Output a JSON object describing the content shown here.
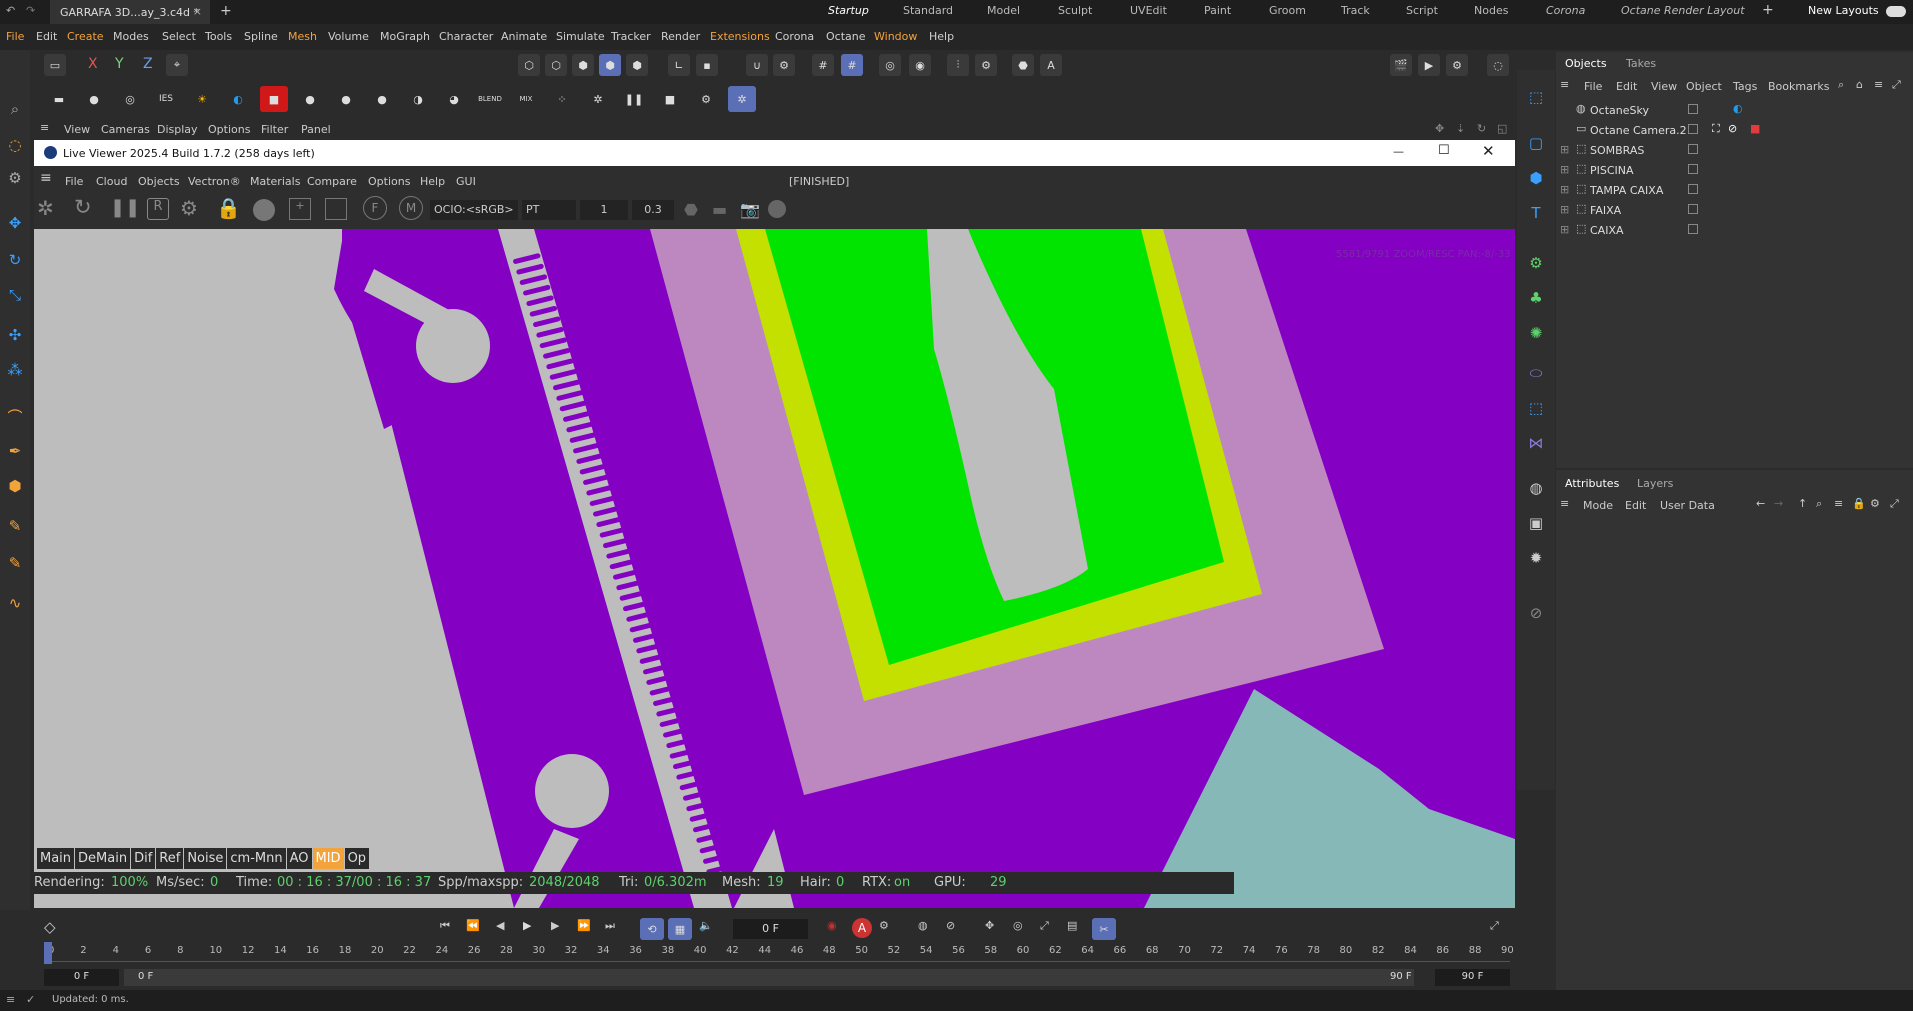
{
  "titlebar": {
    "doc_tab": "GARRAFA 3D...ay_3.c4d *",
    "new_tab": "+",
    "layouts": [
      "Startup",
      "Standard",
      "Model",
      "Sculpt",
      "UVEdit",
      "Paint",
      "Groom",
      "Track",
      "Script",
      "Nodes",
      "Corona",
      "Octane Render Layout"
    ],
    "active_layout": "Startup",
    "add": "+",
    "new_layouts": "New Layouts"
  },
  "menubar": {
    "items": [
      "File",
      "Edit",
      "Create",
      "Modes",
      "Select",
      "Tools",
      "Spline",
      "Mesh",
      "Volume",
      "MoGraph",
      "Character",
      "Animate",
      "Simulate",
      "Tracker",
      "Render",
      "Extensions",
      "Corona",
      "Octane",
      "Window",
      "Help"
    ]
  },
  "coord_buttons": [
    "X",
    "Y",
    "Z"
  ],
  "viewport_menu": [
    "View",
    "Cameras",
    "Display",
    "Options",
    "Filter",
    "Panel"
  ],
  "live_viewer": {
    "title": "Live Viewer 2025.4 Build 1.7.2 (258 days left)",
    "menu": [
      "File",
      "Cloud",
      "Objects",
      "Vectron®",
      "Materials",
      "Compare",
      "Options",
      "Help",
      "GUI"
    ],
    "status": "[FINISHED]",
    "ocio": "OCIO:<sRGB>",
    "kernel": "PT",
    "field1": "1",
    "field2": "0.3",
    "overlay_text": "5581/9791 ZOOM/RESC PAN:-8/-33"
  },
  "layer_buttons": [
    "Main",
    "DeMain",
    "Dif",
    "Ref",
    "Noise",
    "cm-Mnn",
    "AO",
    "MID",
    "Op"
  ],
  "active_layer_button": "MID",
  "render_status": {
    "rendering_label": "Rendering:",
    "rendering_value": "100%",
    "mssec_label": "Ms/sec:",
    "mssec_value": "0",
    "time_label": "Time:",
    "time_value": "00 : 16 : 37/00 : 16 : 37",
    "spp_label": "Spp/maxspp:",
    "spp_value": "2048/2048",
    "tri_label": "Tri:",
    "tri_value": "0/6.302m",
    "mesh_label": "Mesh:",
    "mesh_value": "19",
    "hair_label": "Hair:",
    "hair_value": "0",
    "rtx_label": "RTX:",
    "rtx_value": "on",
    "gpu_label": "GPU:",
    "gpu_value": "29"
  },
  "objects_panel": {
    "tabs": [
      "Objects",
      "Takes"
    ],
    "menu": [
      "File",
      "Edit",
      "View",
      "Object",
      "Tags",
      "Bookmarks"
    ],
    "objects": [
      {
        "name": "OctaneSky"
      },
      {
        "name": "Octane Camera.2"
      },
      {
        "name": "SOMBRAS"
      },
      {
        "name": "PISCINA"
      },
      {
        "name": "TAMPA CAIXA"
      },
      {
        "name": "FAIXA"
      },
      {
        "name": "CAIXA"
      }
    ]
  },
  "attributes_panel": {
    "tabs": [
      "Attributes",
      "Layers"
    ],
    "menu": [
      "Mode",
      "Edit",
      "User Data"
    ]
  },
  "timeline": {
    "current_frame": "0 F",
    "ticks": [
      "0",
      "2",
      "4",
      "6",
      "8",
      "10",
      "12",
      "14",
      "16",
      "18",
      "20",
      "22",
      "24",
      "26",
      "28",
      "30",
      "32",
      "34",
      "36",
      "38",
      "40",
      "42",
      "44",
      "46",
      "48",
      "50",
      "52",
      "54",
      "56",
      "58",
      "60",
      "62",
      "64",
      "66",
      "68",
      "70",
      "72",
      "74",
      "76",
      "78",
      "80",
      "82",
      "84",
      "86",
      "88",
      "90"
    ],
    "start_field": "0 F",
    "start_field2": "0 F",
    "end_field": "90 F",
    "end_field2": "90 F"
  },
  "bottom_status": "Updated: 0 ms.",
  "colors": {
    "viewport_bg": "#8400c2",
    "gray": "#bdbdbd",
    "lilac": "#bd88c0",
    "lime": "#c4e000",
    "green": "#00e400",
    "teal": "#86b8b8",
    "accent": "#f3a33c",
    "status_green": "#5ed06e"
  }
}
